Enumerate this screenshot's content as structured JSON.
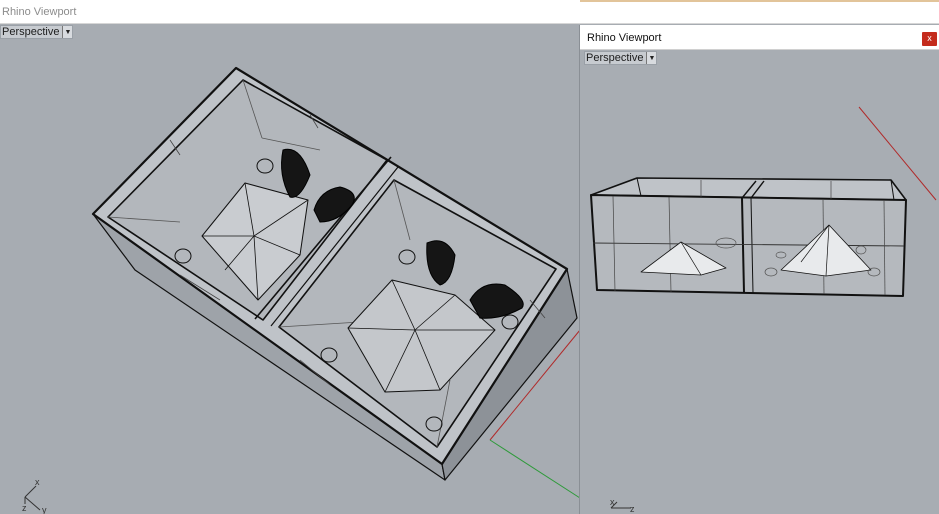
{
  "main_window": {
    "title": "Rhino Viewport",
    "viewport_label": "Perspective",
    "axes": {
      "x": "x",
      "y": "y",
      "z": "z"
    }
  },
  "floating_window": {
    "title": "Rhino Viewport",
    "close_label": "x",
    "viewport_label": "Perspective",
    "axes": {
      "x": "x",
      "z": "z"
    }
  },
  "colors": {
    "background": "#a7acb2",
    "x_axis": "#b02a2a",
    "y_axis": "#2e9a3a",
    "model_edges": "#111111",
    "close_button": "#c42b1c"
  },
  "icons": [
    "chevron-down-icon",
    "close-icon",
    "axis-gizmo-icon"
  ]
}
